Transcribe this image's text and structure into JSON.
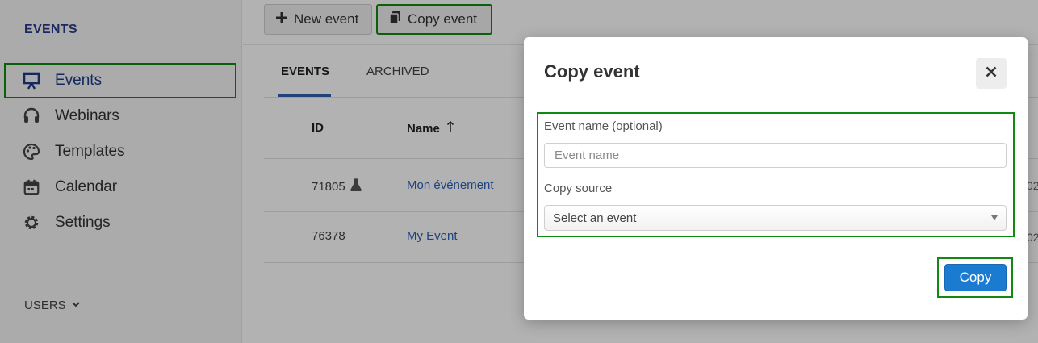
{
  "sidebar": {
    "heading": "EVENTS",
    "items": [
      {
        "label": "Events",
        "icon": "presentation-icon",
        "active": true
      },
      {
        "label": "Webinars",
        "icon": "headset-icon"
      },
      {
        "label": "Templates",
        "icon": "palette-icon"
      },
      {
        "label": "Calendar",
        "icon": "calendar-icon"
      },
      {
        "label": "Settings",
        "icon": "gear-icon"
      }
    ],
    "users_label": "USERS"
  },
  "toolbar": {
    "new_event_label": "New event",
    "copy_event_label": "Copy event"
  },
  "tabs": {
    "events": "EVENTS",
    "archived": "ARCHIVED"
  },
  "table": {
    "headers": {
      "id": "ID",
      "name": "Name"
    },
    "rows": [
      {
        "id": "71805",
        "name": "Mon événement",
        "edge": "02"
      },
      {
        "id": "76378",
        "name": "My Event",
        "edge": "02"
      }
    ]
  },
  "modal": {
    "title": "Copy event",
    "event_name_label": "Event name (optional)",
    "event_name_placeholder": "Event name",
    "copy_source_label": "Copy source",
    "copy_source_placeholder": "Select an event",
    "copy_button": "Copy"
  },
  "colors": {
    "highlight": "#118a11",
    "primary": "#1a7bd0",
    "link": "#2a62b8"
  }
}
